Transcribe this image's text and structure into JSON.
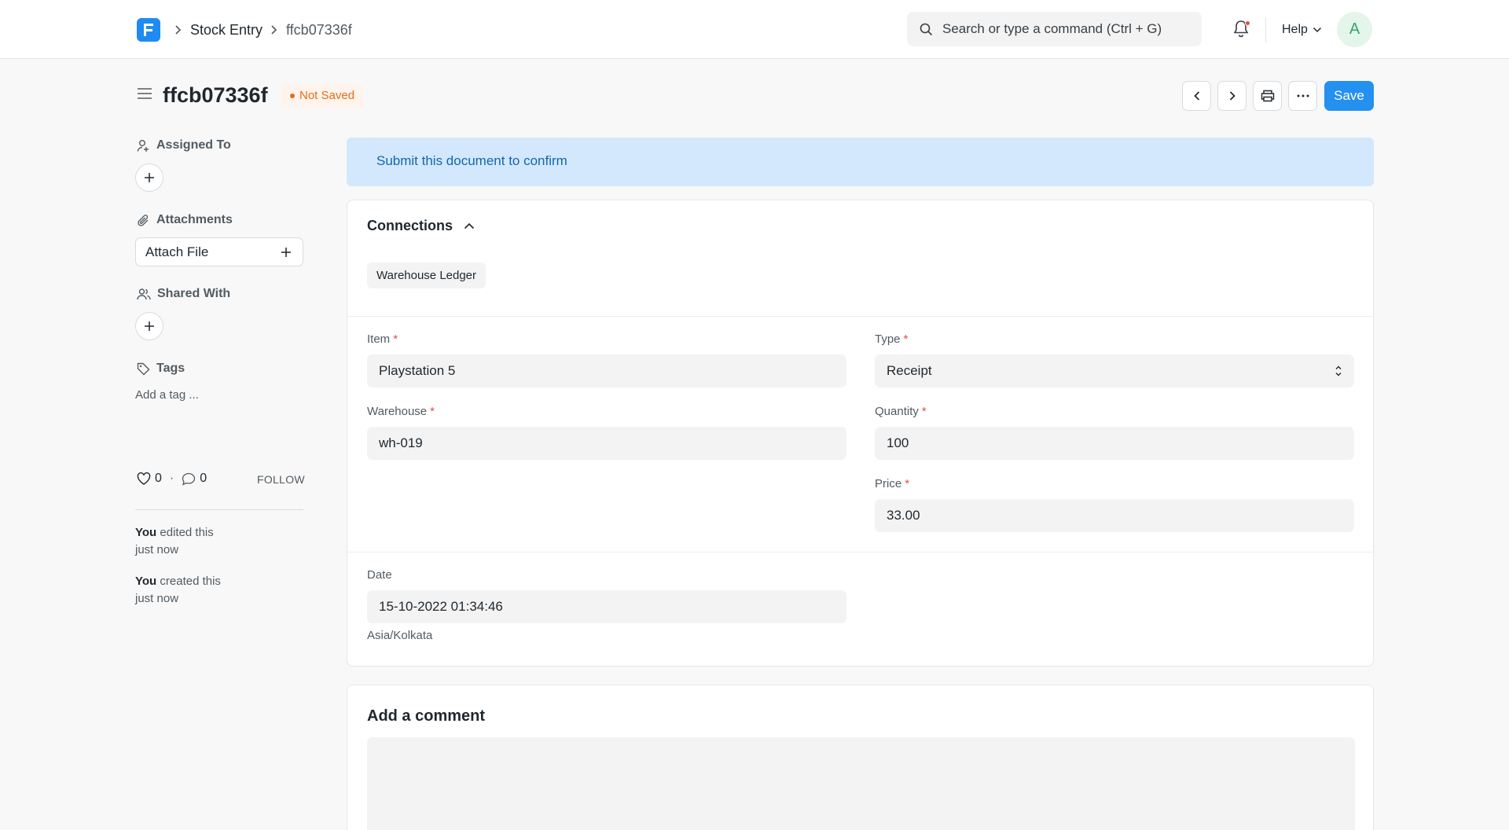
{
  "navbar": {
    "breadcrumbs": [
      "Stock Entry",
      "ffcb07336f"
    ],
    "search_placeholder": "Search or type a command (Ctrl + G)",
    "help_label": "Help",
    "avatar_letter": "A"
  },
  "page": {
    "title": "ffcb07336f",
    "status": "Not Saved",
    "save_label": "Save"
  },
  "sidebar": {
    "assigned_to": "Assigned To",
    "attachments": "Attachments",
    "attach_file": "Attach File",
    "shared_with": "Shared With",
    "tags": "Tags",
    "add_tag": "Add a tag ...",
    "likes": "0",
    "comments": "0",
    "follow": "FOLLOW",
    "activity": [
      {
        "actor": "You",
        "action": " edited this",
        "when": "just now"
      },
      {
        "actor": "You",
        "action": " created this",
        "when": "just now"
      }
    ]
  },
  "alert": "Submit this document to confirm",
  "connections": {
    "heading": "Connections",
    "items": [
      "Warehouse Ledger"
    ]
  },
  "form": {
    "item": {
      "label": "Item",
      "value": "Playstation 5"
    },
    "type": {
      "label": "Type",
      "value": "Receipt"
    },
    "warehouse": {
      "label": "Warehouse",
      "value": "wh-019"
    },
    "quantity": {
      "label": "Quantity",
      "value": "100"
    },
    "price": {
      "label": "Price",
      "value": "33.00"
    },
    "date": {
      "label": "Date",
      "value": "15-10-2022 01:34:46"
    },
    "timezone": "Asia/Kolkata",
    "required_mark": "*"
  },
  "comment": {
    "heading": "Add a comment"
  },
  "colors": {
    "primary": "#2490ef",
    "indicator": "#e86c13",
    "alert_bg": "#d3e8fc",
    "alert_text": "#1366ae"
  }
}
